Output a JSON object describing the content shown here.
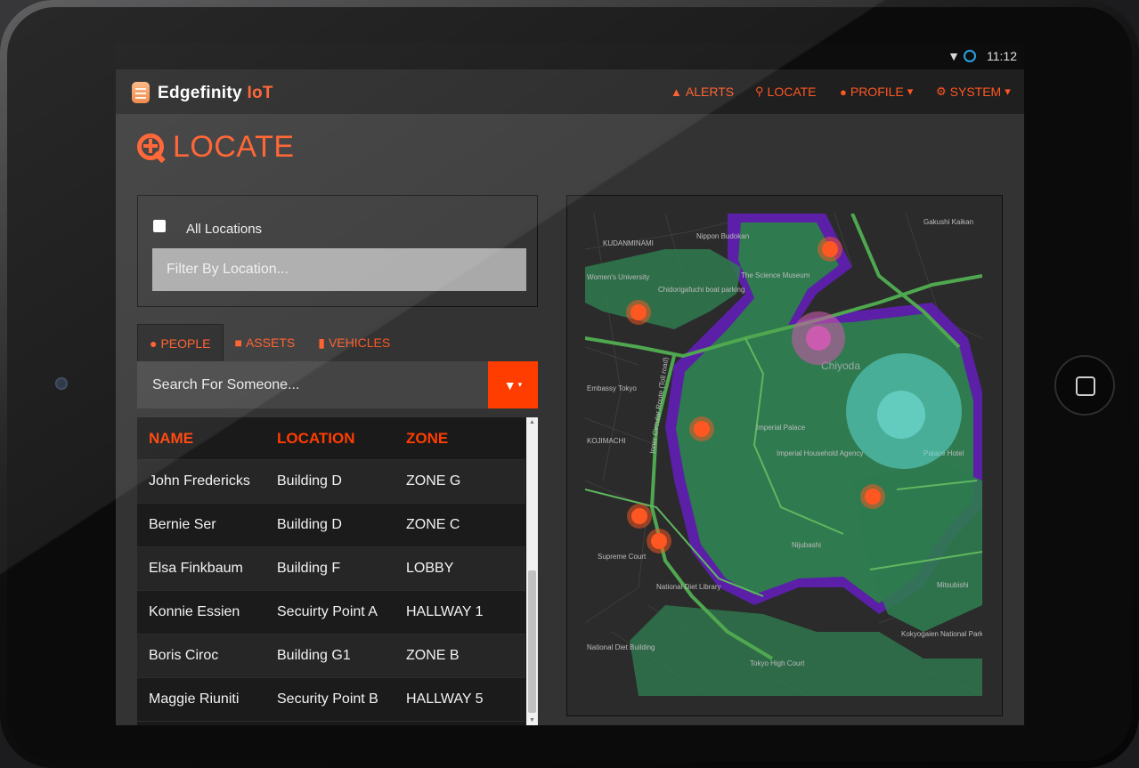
{
  "device": {
    "status_time": "11:12"
  },
  "navbar": {
    "brand_main": "Edgefinity",
    "brand_accent": "IoT",
    "alerts": "ALERTS",
    "locate": "LOCATE",
    "profile": "PROFILE",
    "system": "SYSTEM"
  },
  "page": {
    "title": "LOCATE"
  },
  "filter": {
    "all_locations_label": "All Locations",
    "all_locations_checked": false,
    "location_placeholder": "Filter By Location..."
  },
  "tabs": [
    {
      "label": "PEOPLE",
      "icon": "person-icon",
      "active": true
    },
    {
      "label": "ASSETS",
      "icon": "cube-icon",
      "active": false
    },
    {
      "label": "VEHICLES",
      "icon": "truck-icon",
      "active": false
    }
  ],
  "search": {
    "placeholder": "Search For Someone..."
  },
  "table": {
    "columns": [
      "NAME",
      "LOCATION",
      "ZONE"
    ],
    "rows": [
      [
        "John Fredericks",
        "Building D",
        "ZONE G"
      ],
      [
        "Bernie Ser",
        "Building D",
        "ZONE C"
      ],
      [
        "Elsa Finkbaum",
        "Building F",
        "LOBBY"
      ],
      [
        "Konnie Essien",
        "Secuirty Point A",
        "HALLWAY 1"
      ],
      [
        "Boris Ciroc",
        "Building G1",
        "ZONE B"
      ],
      [
        "Maggie Riuniti",
        "Security Point B",
        "HALLWAY 5"
      ]
    ]
  },
  "map": {
    "labels": {
      "budokan": "Nippon Budokan",
      "science": "The Science Museum",
      "womens": "Women's University",
      "chidorigafuchi": "Chidorigafuchi boat parking",
      "chiyoda": "Chiyoda",
      "palace": "Imperial Palace",
      "agency": "Imperial Household Agency",
      "embassy": "Embassy Tokyo",
      "route": "Inner Circular Route (Toll road)",
      "nijubashi": "Nijubashi",
      "court": "Supreme Court",
      "library": "National Diet Library",
      "diet": "National Diet Building",
      "highcourt": "Tokyo High Court",
      "kokyogaien": "Kokyogaien National Park",
      "mitsubishi": "Mitsubishi",
      "palacehotel": "Palace Hotel",
      "gakushi": "Gakushi Kaikan",
      "kanda": "KUDANMINAMI",
      "kojimachi": "KOJIMACHI"
    },
    "colors": {
      "background": "#2b2b2b",
      "park": "#2f7a4f",
      "moat": "#5b1fa8",
      "road": "#4fa84f",
      "marker": "#ff5722"
    }
  }
}
